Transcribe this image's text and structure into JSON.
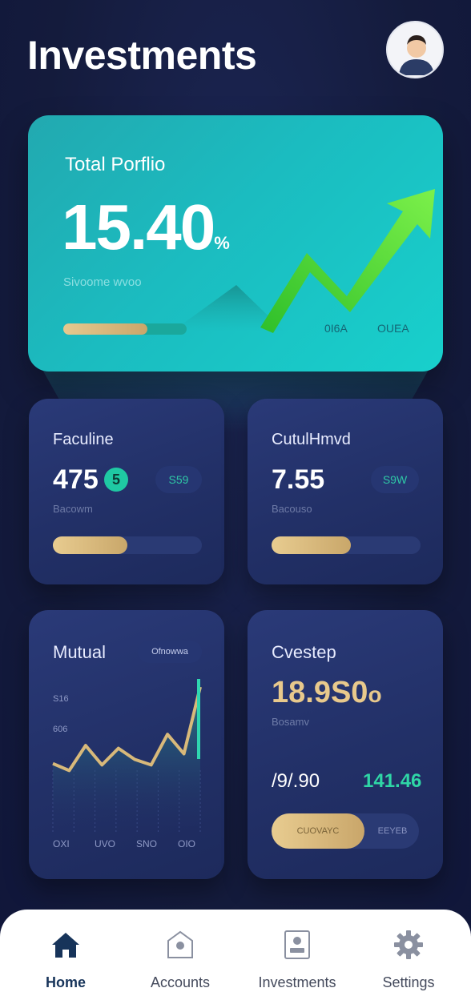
{
  "header": {
    "title": "Investments",
    "avatar_icon": "user-avatar-icon"
  },
  "portfolio": {
    "label": "Total Porflio",
    "value": "15.40",
    "value_suffix": "%",
    "subtitle": "Sivoome wvoo",
    "progress": 0.68,
    "stat_left": "0I6A",
    "stat_right": "OUEA",
    "trend_icon": "trend-up-arrow-icon"
  },
  "cards": {
    "faculine": {
      "title": "Faculine",
      "value": "475",
      "badge": "5",
      "pill": "S59",
      "subtitle": "Bacowm",
      "progress": 0.5
    },
    "cutulhmvd": {
      "title": "CutulHmvd",
      "value": "7.55",
      "pill": "S9W",
      "subtitle": "Bacouso",
      "progress": 0.53
    },
    "mutual": {
      "title": "Mutual",
      "pill": "Ofnowwa",
      "y_ticks": [
        "S16",
        "606"
      ],
      "x_ticks": [
        "OXI",
        "UVO",
        "SNO",
        "OIO"
      ]
    },
    "cvestep": {
      "title": "Cvestep",
      "value": "18.9S0",
      "value_suffix": "o",
      "subtitle": "Bosamv",
      "left_stat": "/9/.90",
      "right_stat": "141.46",
      "toggle_on": "CUOVAYC",
      "toggle_off": "EEYEB"
    }
  },
  "chart_data": {
    "type": "area",
    "title": "Mutual",
    "xlabel": "",
    "ylabel": "",
    "y_ticks": [
      "S16",
      "606"
    ],
    "x": [
      "OXI",
      "UVO",
      "SNO",
      "OIO"
    ],
    "series": [
      {
        "values": [
          45,
          40,
          58,
          44,
          56,
          48,
          44,
          66,
          52,
          100
        ]
      }
    ],
    "grid": false
  },
  "nav": {
    "items": [
      {
        "label": "Home",
        "icon": "home-icon",
        "active": true
      },
      {
        "label": "Accounts",
        "icon": "accounts-icon",
        "active": false
      },
      {
        "label": "Investments",
        "icon": "investments-icon",
        "active": false
      },
      {
        "label": "Settings",
        "icon": "settings-icon",
        "active": false
      }
    ]
  },
  "colors": {
    "background": "#141b3c",
    "hero_teal": "#1bbcc0",
    "trend_green": "#3fd62a",
    "accent_gold": "#d9b97a",
    "accent_mint": "#2fc8a6",
    "card_navy": "#223067"
  }
}
